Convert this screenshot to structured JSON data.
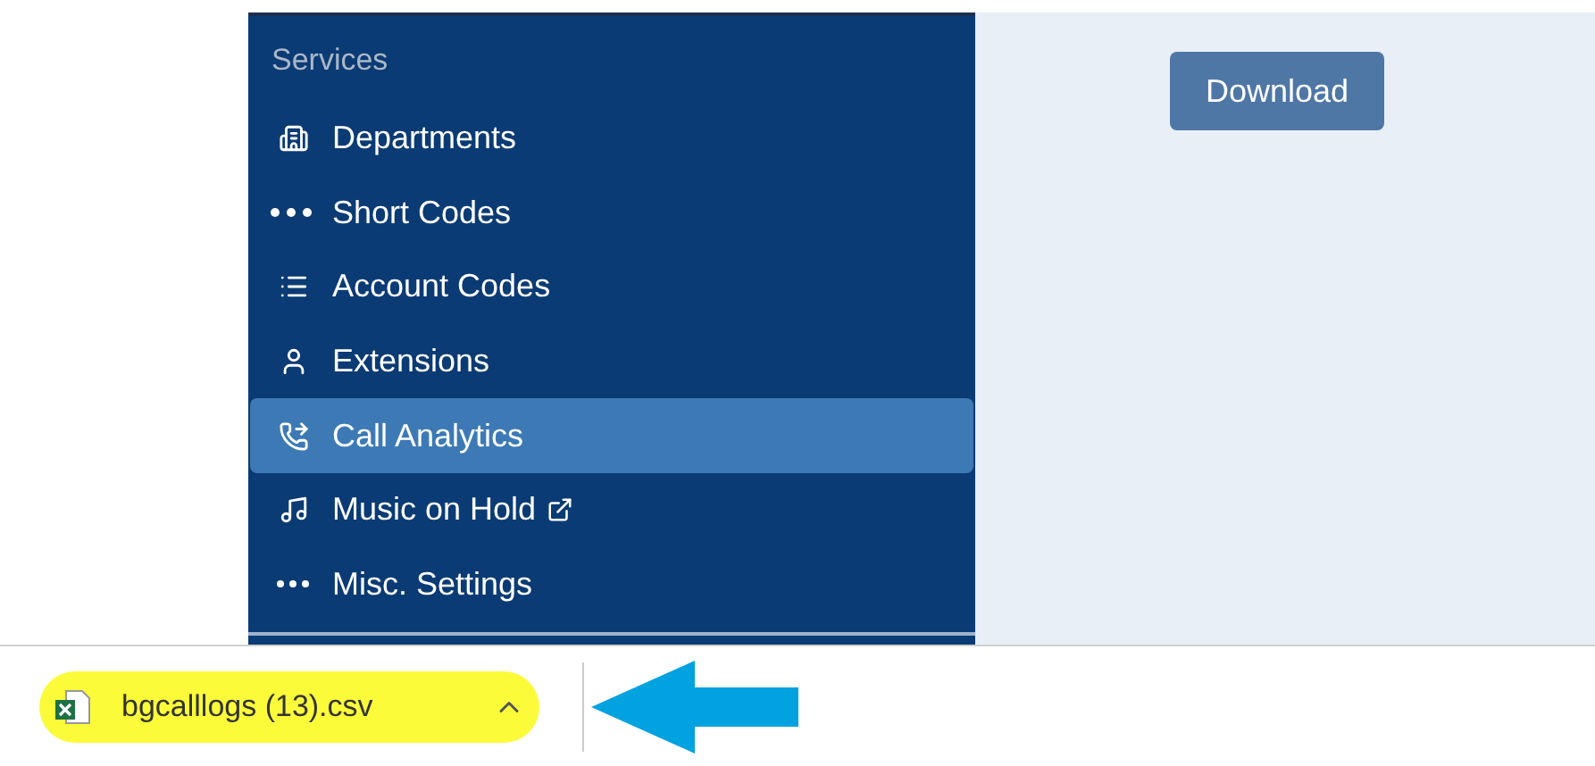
{
  "sidebar": {
    "heading": "Services",
    "items": [
      {
        "label": "Departments",
        "selected": false,
        "external": false
      },
      {
        "label": "Short Codes",
        "selected": false,
        "external": false
      },
      {
        "label": "Account Codes",
        "selected": false,
        "external": false
      },
      {
        "label": "Extensions",
        "selected": false,
        "external": false
      },
      {
        "label": "Call Analytics",
        "selected": true,
        "external": false
      },
      {
        "label": "Music on Hold",
        "selected": false,
        "external": true
      },
      {
        "label": "Misc. Settings",
        "selected": false,
        "external": false
      }
    ]
  },
  "content": {
    "download_button": "Download"
  },
  "download_bar": {
    "file": {
      "name": "bgcalllogs (13).csv",
      "highlighted": true
    }
  }
}
